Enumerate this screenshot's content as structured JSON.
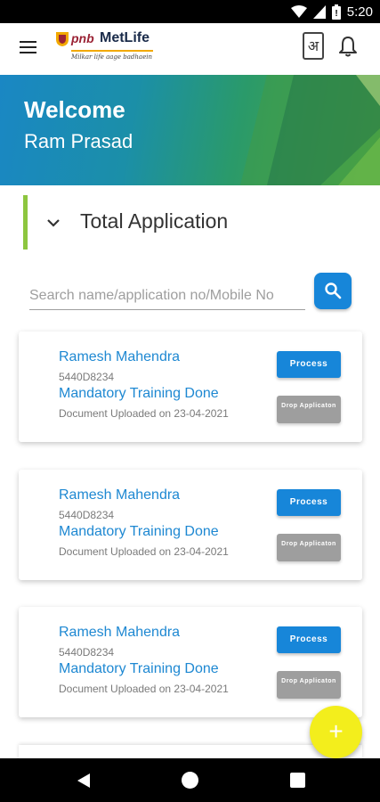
{
  "status_bar": {
    "time": "5:20"
  },
  "app_bar": {
    "logo_pnb": "pnb",
    "logo_metlife": "MetLife",
    "logo_tagline": "Milkar life aage badhaein",
    "language_glyph": "अ"
  },
  "banner": {
    "welcome": "Welcome",
    "user_name": "Ram Prasad"
  },
  "section": {
    "title": "Total Application"
  },
  "search": {
    "placeholder": "Search name/application no/Mobile No",
    "value": ""
  },
  "applications": [
    {
      "name": "Ramesh Mahendra",
      "app_no": "5440D8234",
      "status": "Mandatory Training Done",
      "document": "Document Uploaded on 23-04-2021",
      "process_label": "Process",
      "drop_label": "Drop Applicaton"
    },
    {
      "name": "Ramesh Mahendra",
      "app_no": "5440D8234",
      "status": "Mandatory Training Done",
      "document": "Document Uploaded on 23-04-2021",
      "process_label": "Process",
      "drop_label": "Drop Applicaton"
    },
    {
      "name": "Ramesh Mahendra",
      "app_no": "5440D8234",
      "status": "Mandatory Training Done",
      "document": "Document Uploaded on 23-04-2021",
      "process_label": "Process",
      "drop_label": "Drop Applicaton"
    }
  ],
  "fab": {
    "icon": "plus-icon",
    "label": "+"
  },
  "colors": {
    "primary": "#1786d9",
    "accent_green": "#8dc63f",
    "fab": "#f3ee1c",
    "drop_button": "#9e9e9e"
  }
}
